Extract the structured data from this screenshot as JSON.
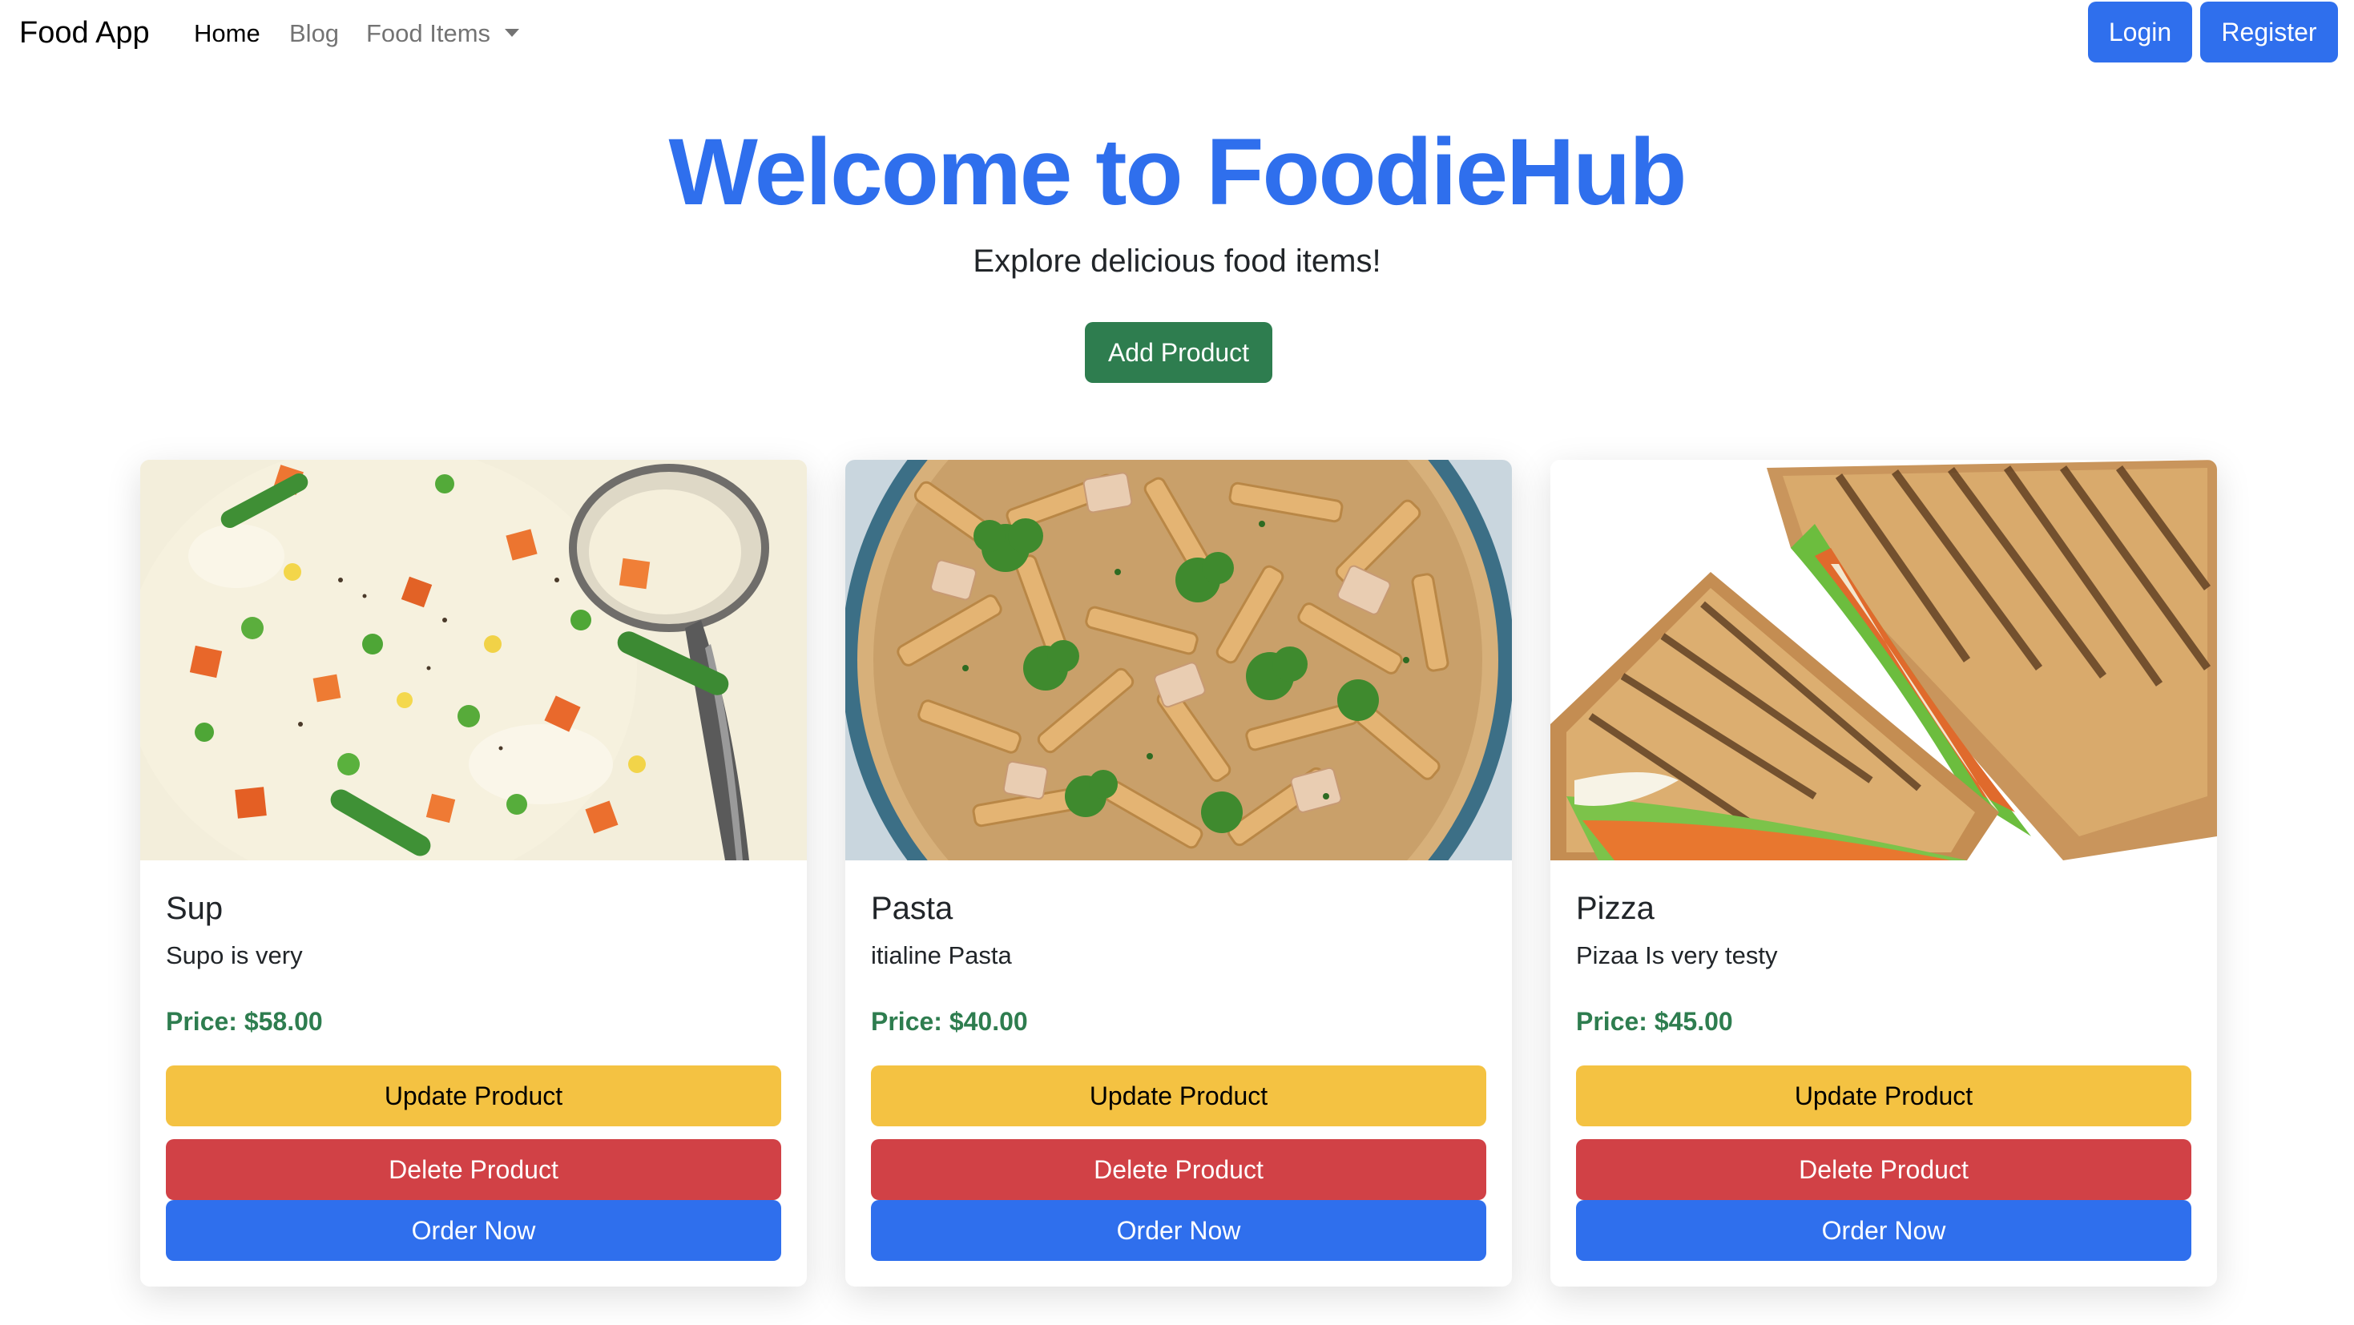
{
  "navbar": {
    "brand": "Food App",
    "links": [
      {
        "label": "Home",
        "active": true
      },
      {
        "label": "Blog",
        "active": false
      },
      {
        "label": "Food Items",
        "active": false,
        "dropdown": true
      }
    ],
    "login_label": "Login",
    "register_label": "Register"
  },
  "hero": {
    "title": "Welcome to FoodieHub",
    "subtitle": "Explore delicious food items!",
    "add_button_label": "Add Product"
  },
  "products": [
    {
      "name": "Sup",
      "description": "Supo is very",
      "price": "Price: $58.00",
      "image_icon": "creamy-soup-image",
      "update_label": "Update Product",
      "delete_label": "Delete Product",
      "order_label": "Order Now"
    },
    {
      "name": "Pasta",
      "description": "itialine Pasta",
      "price": "Price: $40.00",
      "image_icon": "pasta-bowl-image",
      "update_label": "Update Product",
      "delete_label": "Delete Product",
      "order_label": "Order Now"
    },
    {
      "name": "Pizza",
      "description": "Pizaa Is very testy",
      "price": "Price: $45.00",
      "image_icon": "sandwich-image",
      "update_label": "Update Product",
      "delete_label": "Delete Product",
      "order_label": "Order Now"
    }
  ],
  "colors": {
    "primary": "#2f6fed",
    "success": "#2e7d4f",
    "warning": "#f4c242",
    "danger": "#d14146"
  }
}
